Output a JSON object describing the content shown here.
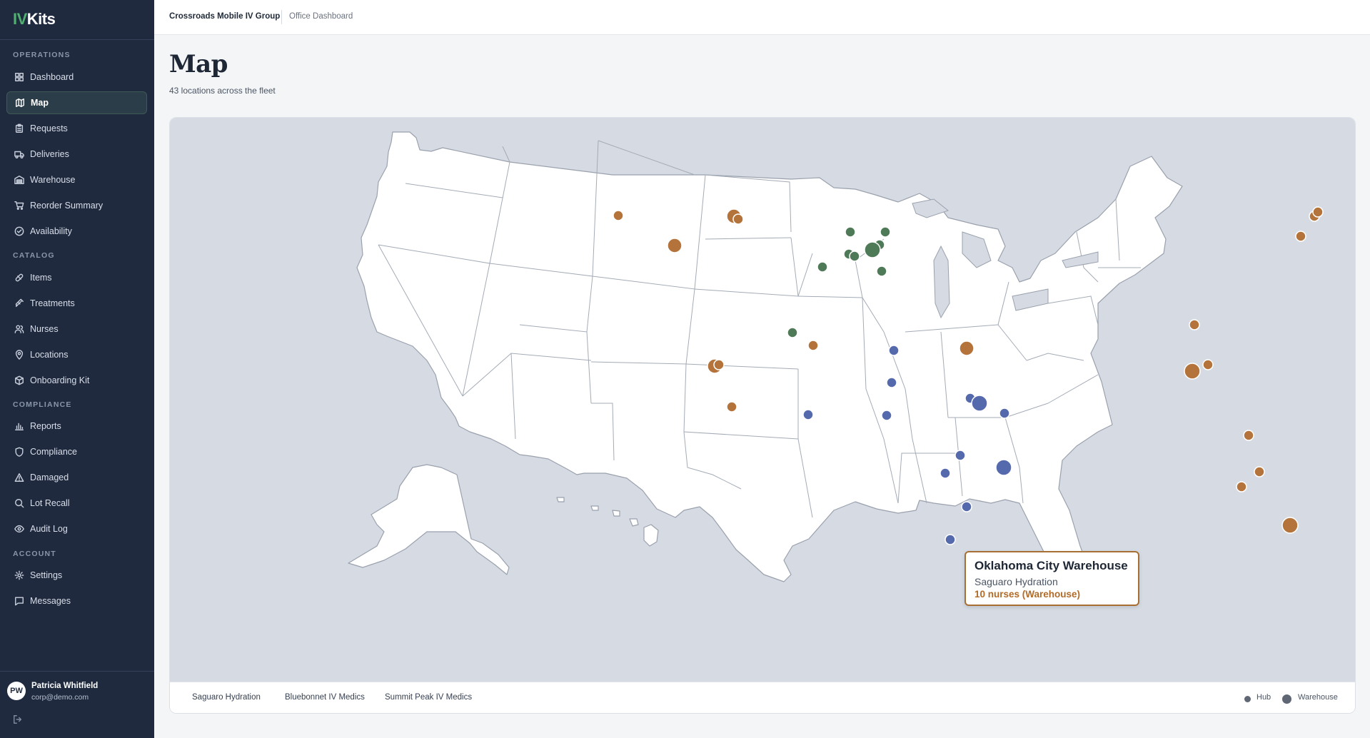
{
  "app": {
    "logo_prefix": "IV",
    "logo_suffix": "Kits"
  },
  "breadcrumb": {
    "org": "Crossroads Mobile IV Group",
    "page": "Office Dashboard"
  },
  "page": {
    "title": "Map",
    "subtitle": "43 locations across the fleet"
  },
  "sidebar": {
    "sections": {
      "operations": "OPERATIONS",
      "catalog": "CATALOG",
      "compliance": "COMPLIANCE",
      "account": "ACCOUNT"
    },
    "items": [
      {
        "label": "Dashboard",
        "icon": "dashboard-icon"
      },
      {
        "label": "Map",
        "icon": "map-icon"
      },
      {
        "label": "Requests",
        "icon": "clipboard-icon"
      },
      {
        "label": "Deliveries",
        "icon": "truck-icon"
      },
      {
        "label": "Warehouse",
        "icon": "warehouse-icon"
      },
      {
        "label": "Reorder Summary",
        "icon": "cart-icon"
      },
      {
        "label": "Availability",
        "icon": "check-circle-icon"
      },
      {
        "label": "Items",
        "icon": "pill-icon"
      },
      {
        "label": "Treatments",
        "icon": "syringe-icon"
      },
      {
        "label": "Nurses",
        "icon": "users-icon"
      },
      {
        "label": "Locations",
        "icon": "pin-icon"
      },
      {
        "label": "Onboarding Kit",
        "icon": "box-icon"
      },
      {
        "label": "Reports",
        "icon": "bar-chart-icon"
      },
      {
        "label": "Compliance",
        "icon": "shield-icon"
      },
      {
        "label": "Damaged",
        "icon": "warning-icon"
      },
      {
        "label": "Lot Recall",
        "icon": "search-icon"
      },
      {
        "label": "Audit Log",
        "icon": "eye-icon"
      },
      {
        "label": "Settings",
        "icon": "gear-icon"
      },
      {
        "label": "Messages",
        "icon": "message-icon"
      }
    ],
    "active": "Map"
  },
  "user": {
    "initials": "PW",
    "name": "Patricia Whitfield",
    "email": "corp@demo.com"
  },
  "map": {
    "tooltip": {
      "title": "Oklahoma City Warehouse",
      "company": "Saguaro Hydration",
      "detail": "10 nurses (Warehouse)"
    },
    "companies": [
      {
        "name": "Saguaro Hydration",
        "color": "#b4733a"
      },
      {
        "name": "Bluebonnet IV Medics",
        "color": "#5569ad"
      },
      {
        "name": "Summit Peak IV Medics",
        "color": "#4f7a57"
      }
    ],
    "legend": {
      "hub": "Hub",
      "warehouse": "Warehouse"
    }
  }
}
